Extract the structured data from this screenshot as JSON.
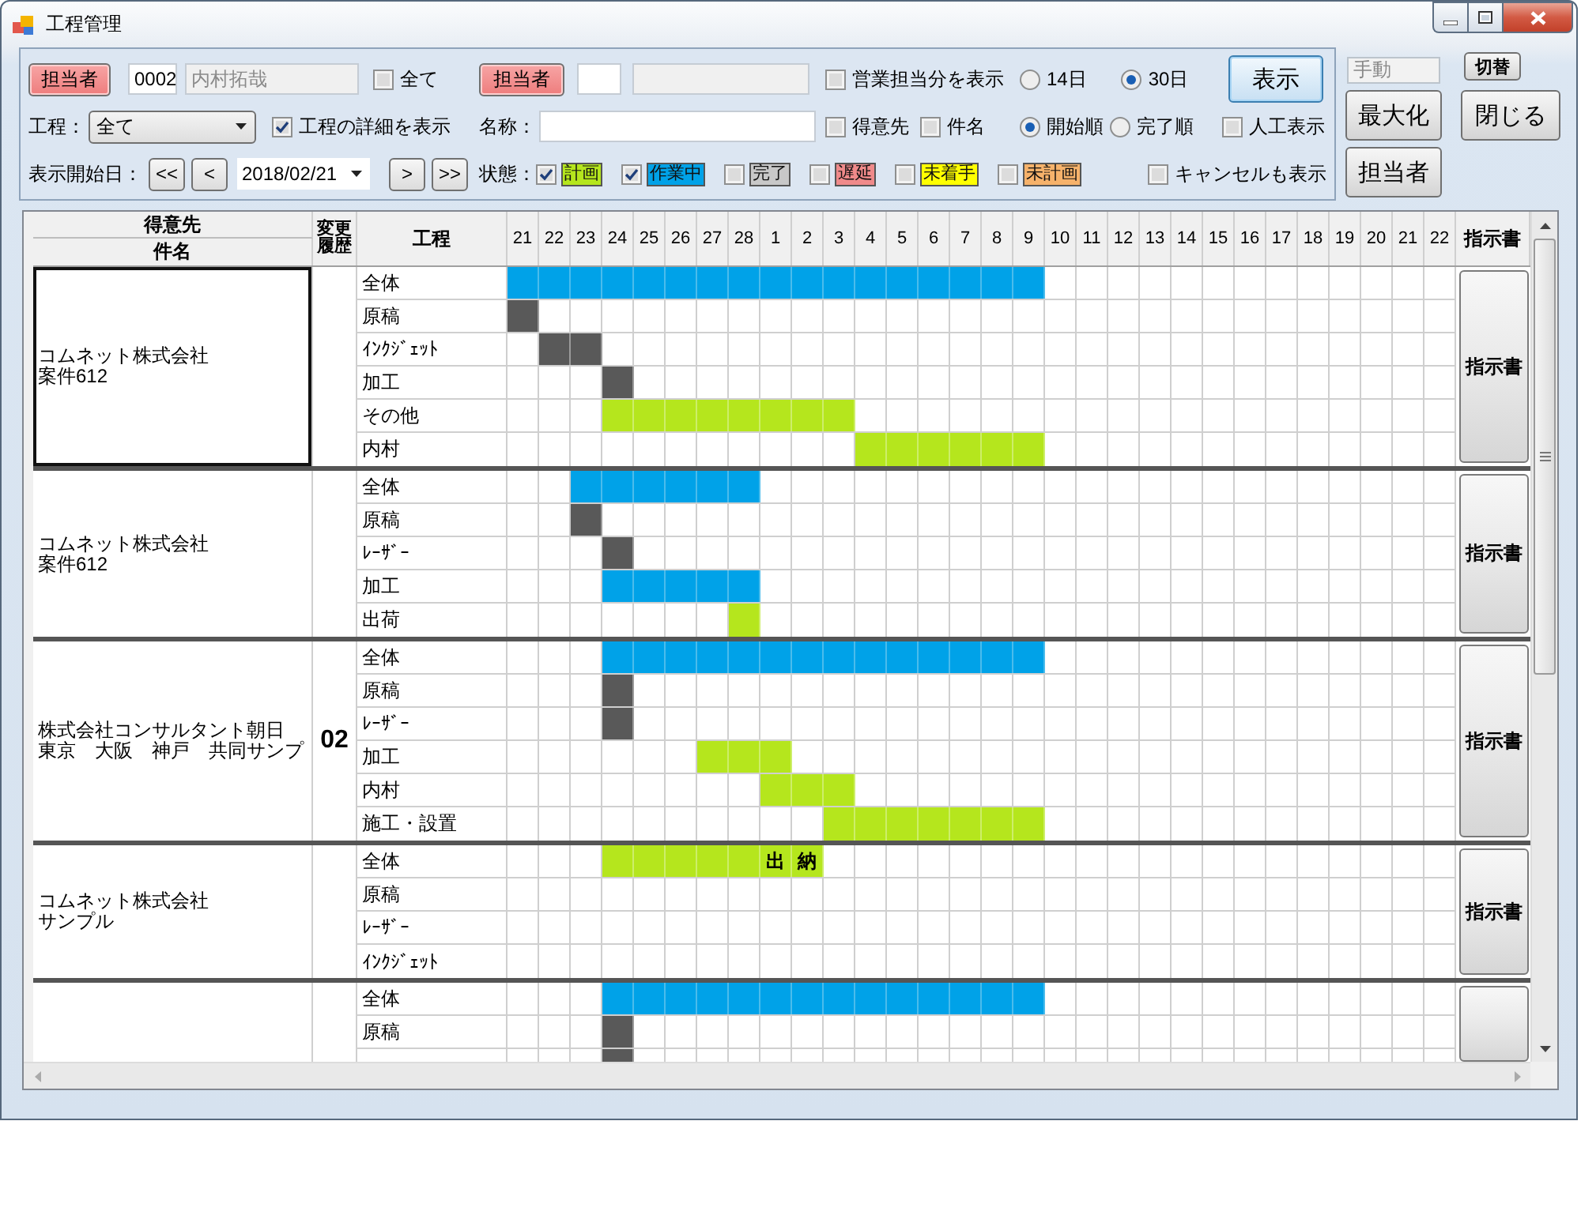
{
  "window": {
    "title": "工程管理"
  },
  "filters": {
    "staff": {
      "button": "担当者",
      "code": "0002",
      "name": "内村拓哉"
    },
    "all_staff": {
      "label": "全て",
      "checked": false
    },
    "sales_staff": {
      "button": "担当者"
    },
    "sales_only": {
      "label": "営業担当分を表示",
      "checked": false
    },
    "ranges": [
      {
        "label": "14日",
        "selected": false
      },
      {
        "label": "30日",
        "selected": true
      }
    ],
    "show_button": "表示",
    "process": {
      "label": "工程：",
      "value": "全て"
    },
    "process_detail": {
      "label": "工程の詳細を表示",
      "checked": true
    },
    "name_label": "名称：",
    "name_scopes": [
      {
        "label": "得意先",
        "checked": false
      },
      {
        "label": "件名",
        "checked": false
      }
    ],
    "orders": [
      {
        "label": "開始順",
        "selected": true
      },
      {
        "label": "完了順",
        "selected": false
      }
    ],
    "manpower": {
      "label": "人工表示",
      "checked": false
    },
    "start": {
      "label": "表示開始日：",
      "back_buttons": [
        "<<",
        "<"
      ],
      "date": "2018/02/21",
      "forward_buttons": [
        ">",
        ">>"
      ]
    },
    "status_label": "状態：",
    "statuses": [
      {
        "label": "計画",
        "checked": true,
        "color": "#b5e61d"
      },
      {
        "label": "作業中",
        "checked": true,
        "color": "#00a2e8"
      },
      {
        "label": "完了",
        "checked": false,
        "color": "#c8c8c8"
      },
      {
        "label": "遅延",
        "checked": false,
        "color": "#f08a8a"
      },
      {
        "label": "未着手",
        "checked": false,
        "color": "#ffff00"
      },
      {
        "label": "未計画",
        "checked": false,
        "color": "#f6b26b"
      }
    ],
    "show_cancelled": {
      "label": "キャンセルも表示",
      "checked": false
    }
  },
  "side": {
    "mode": "手動",
    "switch_button": "切替",
    "maximize_button": "最大化",
    "close_button": "閉じる",
    "staff_button": "担当者"
  },
  "grid": {
    "headers": {
      "customer": "得意先",
      "project": "件名",
      "history": "変更履歴",
      "process": "工程",
      "instruction": "指示書"
    },
    "days": [
      "21",
      "22",
      "23",
      "24",
      "25",
      "26",
      "27",
      "28",
      "1",
      "2",
      "3",
      "4",
      "5",
      "6",
      "7",
      "8",
      "9",
      "10",
      "11",
      "12",
      "13",
      "14",
      "15",
      "16",
      "17",
      "18",
      "19",
      "20",
      "21",
      "22"
    ],
    "groups": [
      {
        "customer": "コムネット株式会社",
        "project": "案件612",
        "selected": true,
        "instruction_button": "指示書",
        "rows": [
          {
            "process": "全体",
            "cells": [
              {
                "kind": "work"
              },
              {
                "kind": "work"
              },
              {
                "kind": "work"
              },
              {
                "kind": "work"
              },
              {
                "kind": "work"
              },
              {
                "kind": "work"
              },
              {
                "kind": "work"
              },
              {
                "kind": "work"
              },
              {
                "kind": "work"
              },
              {
                "kind": "work"
              },
              {
                "kind": "work"
              },
              {
                "kind": "work"
              },
              {
                "kind": "work"
              },
              {
                "kind": "work"
              },
              {
                "kind": "work"
              },
              {
                "kind": "work"
              },
              {
                "kind": "work"
              }
            ]
          },
          {
            "process": "原稿",
            "cells": [
              {
                "kind": "done"
              }
            ]
          },
          {
            "process": "ｲﾝｸｼﾞｪｯﾄ",
            "cells": [
              {
                "kind": "none"
              },
              {
                "kind": "done"
              },
              {
                "kind": "done"
              }
            ]
          },
          {
            "process": "加工",
            "cells": [
              {
                "kind": "none"
              },
              {
                "kind": "none"
              },
              {
                "kind": "none"
              },
              {
                "kind": "done"
              }
            ]
          },
          {
            "process": "その他",
            "cells": [
              {
                "kind": "none"
              },
              {
                "kind": "none"
              },
              {
                "kind": "none"
              },
              {
                "kind": "plan"
              },
              {
                "kind": "plan"
              },
              {
                "kind": "plan"
              },
              {
                "kind": "plan"
              },
              {
                "kind": "plan"
              },
              {
                "kind": "plan"
              },
              {
                "kind": "plan"
              },
              {
                "kind": "plan"
              }
            ]
          },
          {
            "process": "内村",
            "cells": [
              {
                "kind": "none"
              },
              {
                "kind": "none"
              },
              {
                "kind": "none"
              },
              {
                "kind": "none"
              },
              {
                "kind": "none"
              },
              {
                "kind": "none"
              },
              {
                "kind": "none"
              },
              {
                "kind": "none"
              },
              {
                "kind": "none"
              },
              {
                "kind": "none"
              },
              {
                "kind": "none"
              },
              {
                "kind": "plan"
              },
              {
                "kind": "plan"
              },
              {
                "kind": "plan"
              },
              {
                "kind": "plan"
              },
              {
                "kind": "plan"
              },
              {
                "kind": "plan"
              }
            ]
          }
        ]
      },
      {
        "customer": "コムネット株式会社",
        "project": "案件612",
        "selected": false,
        "instruction_button": "指示書",
        "rows": [
          {
            "process": "全体",
            "cells": [
              {
                "kind": "none"
              },
              {
                "kind": "none"
              },
              {
                "kind": "work"
              },
              {
                "kind": "work"
              },
              {
                "kind": "work"
              },
              {
                "kind": "work"
              },
              {
                "kind": "work"
              },
              {
                "kind": "work"
              }
            ]
          },
          {
            "process": "原稿",
            "cells": [
              {
                "kind": "none"
              },
              {
                "kind": "none"
              },
              {
                "kind": "done"
              }
            ]
          },
          {
            "process": "ﾚｰｻﾞｰ",
            "cells": [
              {
                "kind": "none"
              },
              {
                "kind": "none"
              },
              {
                "kind": "none"
              },
              {
                "kind": "done"
              }
            ]
          },
          {
            "process": "加工",
            "cells": [
              {
                "kind": "none"
              },
              {
                "kind": "none"
              },
              {
                "kind": "none"
              },
              {
                "kind": "work"
              },
              {
                "kind": "work"
              },
              {
                "kind": "work"
              },
              {
                "kind": "work"
              },
              {
                "kind": "work"
              }
            ]
          },
          {
            "process": "出荷",
            "cells": [
              {
                "kind": "none"
              },
              {
                "kind": "none"
              },
              {
                "kind": "none"
              },
              {
                "kind": "none"
              },
              {
                "kind": "none"
              },
              {
                "kind": "none"
              },
              {
                "kind": "none"
              },
              {
                "kind": "plan"
              }
            ]
          }
        ]
      },
      {
        "customer": "株式会社コンサルタント朝日",
        "project": "東京　大阪　神戸　共同サンプ",
        "history": "02",
        "selected": false,
        "instruction_button": "指示書",
        "rows": [
          {
            "process": "全体",
            "cells": [
              {
                "kind": "none"
              },
              {
                "kind": "none"
              },
              {
                "kind": "none"
              },
              {
                "kind": "work"
              },
              {
                "kind": "work"
              },
              {
                "kind": "work"
              },
              {
                "kind": "work"
              },
              {
                "kind": "work"
              },
              {
                "kind": "work"
              },
              {
                "kind": "work"
              },
              {
                "kind": "work"
              },
              {
                "kind": "work"
              },
              {
                "kind": "work"
              },
              {
                "kind": "work"
              },
              {
                "kind": "work"
              },
              {
                "kind": "work"
              },
              {
                "kind": "work"
              }
            ]
          },
          {
            "process": "原稿",
            "cells": [
              {
                "kind": "none"
              },
              {
                "kind": "none"
              },
              {
                "kind": "none"
              },
              {
                "kind": "done"
              }
            ]
          },
          {
            "process": "ﾚｰｻﾞｰ",
            "cells": [
              {
                "kind": "none"
              },
              {
                "kind": "none"
              },
              {
                "kind": "none"
              },
              {
                "kind": "done"
              }
            ]
          },
          {
            "process": "加工",
            "cells": [
              {
                "kind": "none"
              },
              {
                "kind": "none"
              },
              {
                "kind": "none"
              },
              {
                "kind": "none"
              },
              {
                "kind": "none"
              },
              {
                "kind": "none"
              },
              {
                "kind": "plan"
              },
              {
                "kind": "plan"
              },
              {
                "kind": "plan"
              }
            ]
          },
          {
            "process": "内村",
            "cells": [
              {
                "kind": "none"
              },
              {
                "kind": "none"
              },
              {
                "kind": "none"
              },
              {
                "kind": "none"
              },
              {
                "kind": "none"
              },
              {
                "kind": "none"
              },
              {
                "kind": "none"
              },
              {
                "kind": "none"
              },
              {
                "kind": "plan"
              },
              {
                "kind": "plan"
              },
              {
                "kind": "plan"
              }
            ]
          },
          {
            "process": "施工・設置",
            "cells": [
              {
                "kind": "none"
              },
              {
                "kind": "none"
              },
              {
                "kind": "none"
              },
              {
                "kind": "none"
              },
              {
                "kind": "none"
              },
              {
                "kind": "none"
              },
              {
                "kind": "none"
              },
              {
                "kind": "none"
              },
              {
                "kind": "none"
              },
              {
                "kind": "none"
              },
              {
                "kind": "plan"
              },
              {
                "kind": "plan"
              },
              {
                "kind": "plan"
              },
              {
                "kind": "plan"
              },
              {
                "kind": "plan"
              },
              {
                "kind": "plan"
              },
              {
                "kind": "plan"
              }
            ]
          }
        ]
      },
      {
        "customer": "コムネット株式会社",
        "project": "サンプル",
        "selected": false,
        "instruction_button": "指示書",
        "rows": [
          {
            "process": "全体",
            "cells": [
              {
                "kind": "none"
              },
              {
                "kind": "none"
              },
              {
                "kind": "none"
              },
              {
                "kind": "plan"
              },
              {
                "kind": "plan"
              },
              {
                "kind": "plan"
              },
              {
                "kind": "plan"
              },
              {
                "kind": "plan"
              },
              {
                "kind": "plan",
                "text": "出"
              },
              {
                "kind": "plan",
                "text": "納"
              }
            ]
          },
          {
            "process": "原稿"
          },
          {
            "process": "ﾚｰｻﾞｰ"
          },
          {
            "process": "ｲﾝｸｼﾞｪｯﾄ"
          }
        ]
      },
      {
        "selected": false,
        "rows": [
          {
            "process": "全体",
            "cells": [
              {
                "kind": "none"
              },
              {
                "kind": "none"
              },
              {
                "kind": "none"
              },
              {
                "kind": "work"
              },
              {
                "kind": "work"
              },
              {
                "kind": "work"
              },
              {
                "kind": "work"
              },
              {
                "kind": "work"
              },
              {
                "kind": "work"
              },
              {
                "kind": "work"
              },
              {
                "kind": "work"
              },
              {
                "kind": "work"
              },
              {
                "kind": "work"
              },
              {
                "kind": "work"
              },
              {
                "kind": "work"
              },
              {
                "kind": "work"
              },
              {
                "kind": "work"
              }
            ]
          },
          {
            "process": "原稿",
            "cells": [
              {
                "kind": "none"
              },
              {
                "kind": "none"
              },
              {
                "kind": "none"
              },
              {
                "kind": "done"
              }
            ]
          },
          {
            "cells": [
              {
                "kind": "none"
              },
              {
                "kind": "none"
              },
              {
                "kind": "none"
              },
              {
                "kind": "done"
              }
            ]
          }
        ]
      }
    ]
  }
}
